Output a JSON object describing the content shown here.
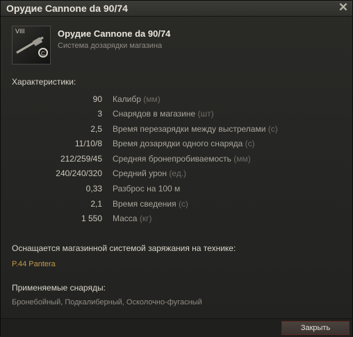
{
  "window": {
    "title": "Орудие Cannone da 90/74"
  },
  "header": {
    "tier": "VIII",
    "gun_name": "Орудие Cannone da 90/74",
    "subtitle": "Система дозарядки магазина",
    "icon": "gun-icon"
  },
  "characteristics": {
    "heading": "Характеристики:",
    "rows": [
      {
        "value": "90",
        "label": "Калибр",
        "unit": "(мм)"
      },
      {
        "value": "3",
        "label": "Снарядов в магазине",
        "unit": "(шт)"
      },
      {
        "value": "2,5",
        "label": "Время перезарядки между выстрелами",
        "unit": "(с)"
      },
      {
        "value": "11/10/8",
        "label": "Время дозарядки одного снаряда",
        "unit": "(с)"
      },
      {
        "value": "212/259/45",
        "label": "Средняя бронепробиваемость",
        "unit": "(мм)"
      },
      {
        "value": "240/240/320",
        "label": "Средний урон",
        "unit": "(ед.)"
      },
      {
        "value": "0,33",
        "label": "Разброс на 100 м",
        "unit": ""
      },
      {
        "value": "2,1",
        "label": "Время сведения",
        "unit": "(с)"
      },
      {
        "value": "1 550",
        "label": "Масса",
        "unit": "(кг)"
      }
    ]
  },
  "vehicles": {
    "heading": "Оснащается магазинной системой заряжания на технике:",
    "list": "P.44 Pantera"
  },
  "shells": {
    "heading": "Применяемые снаряды:",
    "list": "Бронебойный, Подкалиберный, Осколочно-фугасный"
  },
  "buttons": {
    "close_label": "Закрыть"
  },
  "colors": {
    "accent_vehicle": "#c49a4c",
    "button_border": "#5e2a22"
  }
}
